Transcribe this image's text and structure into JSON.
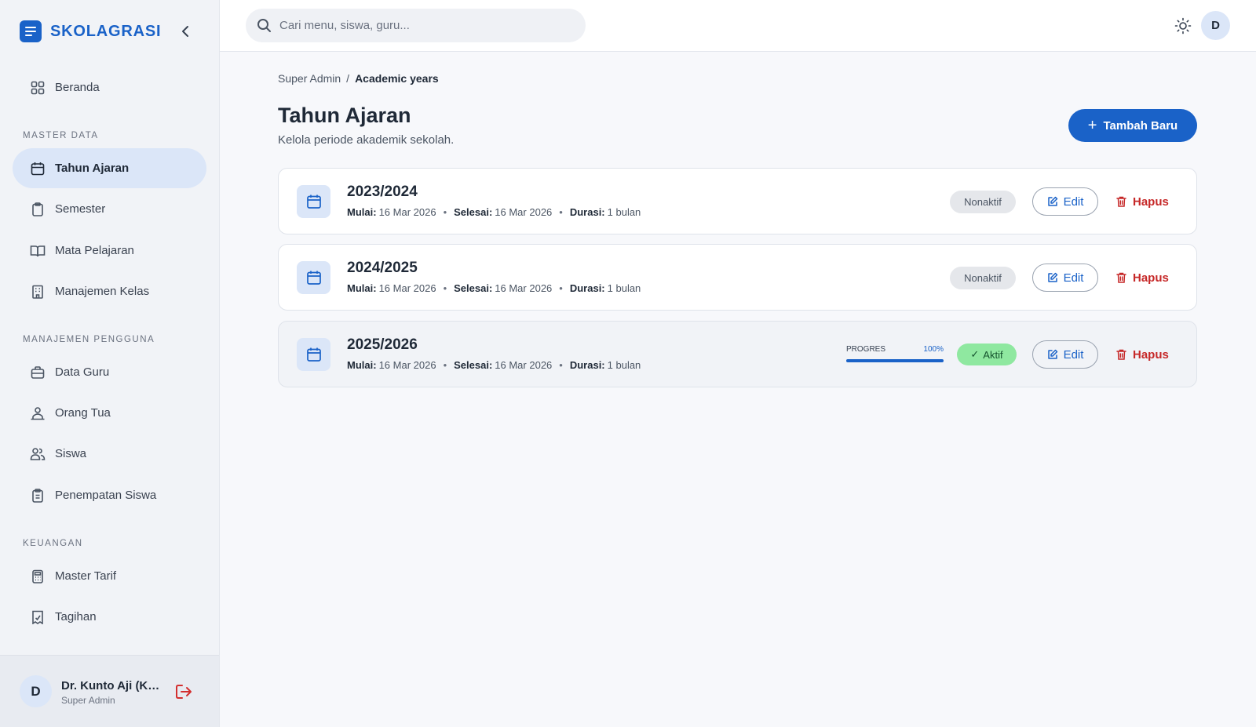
{
  "brand": {
    "name": "SKOLAGRASI"
  },
  "search": {
    "placeholder": "Cari menu, siswa, guru..."
  },
  "header": {
    "avatar_initial": "D"
  },
  "sidebar": {
    "home": {
      "label": "Beranda",
      "icon": "grid-icon"
    },
    "sections": [
      {
        "title": "MASTER DATA",
        "items": [
          {
            "label": "Tahun Ajaran",
            "icon": "calendar-icon",
            "active": true
          },
          {
            "label": "Semester",
            "icon": "clipboard-icon"
          },
          {
            "label": "Mata Pelajaran",
            "icon": "book-icon"
          },
          {
            "label": "Manajemen Kelas",
            "icon": "building-icon"
          }
        ]
      },
      {
        "title": "MANAJEMEN PENGGUNA",
        "items": [
          {
            "label": "Data Guru",
            "icon": "briefcase-icon"
          },
          {
            "label": "Orang Tua",
            "icon": "parent-icon"
          },
          {
            "label": "Siswa",
            "icon": "users-icon"
          },
          {
            "label": "Penempatan Siswa",
            "icon": "clipboard-list-icon"
          }
        ]
      },
      {
        "title": "KEUANGAN",
        "items": [
          {
            "label": "Master Tarif",
            "icon": "calculator-icon"
          },
          {
            "label": "Tagihan",
            "icon": "receipt-icon"
          }
        ]
      }
    ],
    "user": {
      "initial": "D",
      "name": "Dr. Kunto Aji (Ke...",
      "role": "Super Admin"
    }
  },
  "breadcrumb": {
    "root": "Super Admin",
    "separator": "/",
    "current": "Academic years"
  },
  "page": {
    "title": "Tahun Ajaran",
    "subtitle": "Kelola periode akademik sekolah.",
    "add_button": "Tambah Baru"
  },
  "labels": {
    "start": "Mulai:",
    "end": "Selesai:",
    "duration": "Durasi:",
    "edit": "Edit",
    "delete": "Hapus",
    "progress": "PROGRES"
  },
  "years": [
    {
      "year": "2023/2024",
      "start": "16 Mar 2026",
      "end": "16 Mar 2026",
      "duration": "1 bulan",
      "status": "Nonaktif",
      "active": false
    },
    {
      "year": "2024/2025",
      "start": "16 Mar 2026",
      "end": "16 Mar 2026",
      "duration": "1 bulan",
      "status": "Nonaktif",
      "active": false
    },
    {
      "year": "2025/2026",
      "start": "16 Mar 2026",
      "end": "16 Mar 2026",
      "duration": "1 bulan",
      "status": "Aktif",
      "active": true,
      "progress_text": "100%",
      "progress": 1.0
    }
  ],
  "colors": {
    "primary": "#1a62c8",
    "danger": "#c62828",
    "active_badge": "#8fe8a0"
  }
}
